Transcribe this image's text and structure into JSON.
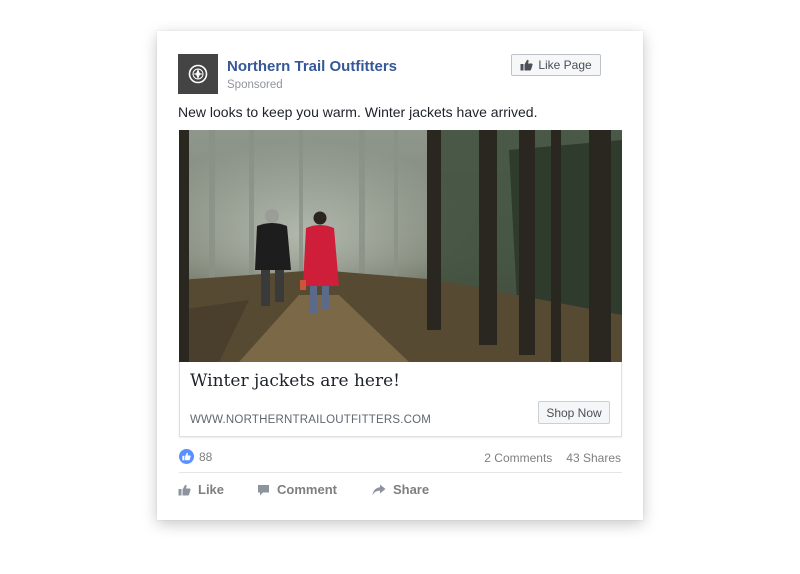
{
  "post": {
    "page_name": "Northern Trail Outfitters",
    "sponsored_label": "Sponsored",
    "like_page_label": "Like Page",
    "text": "New looks to keep you warm. Winter jackets have arrived.",
    "icons": {
      "avatar": "compass-logo-icon",
      "like_page": "thumbs-up-icon"
    },
    "colors": {
      "page_name": "#365899",
      "like_bubble": "#5890ff"
    }
  },
  "link_preview": {
    "headline": "Winter jackets are here!",
    "domain": "WWW.NORTHERNTRAILOUTFITTERS.COM",
    "cta_label": "Shop Now"
  },
  "engagement": {
    "reaction_count": "88",
    "comments": "2 Comments",
    "shares": "43 Shares"
  },
  "actions": [
    {
      "label": "Like",
      "icon": "thumbs-up-icon"
    },
    {
      "label": "Comment",
      "icon": "comment-icon"
    },
    {
      "label": "Share",
      "icon": "share-arrow-icon"
    }
  ]
}
